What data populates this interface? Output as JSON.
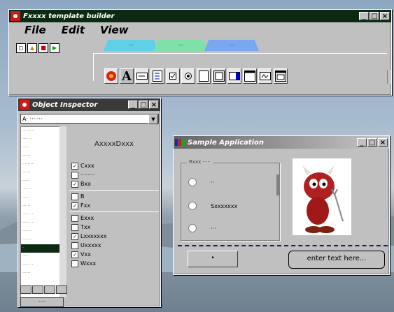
{
  "builder": {
    "title": "Fxxxx template builder",
    "menu": [
      "File",
      "Edit",
      "View"
    ],
    "tabs": [
      {
        "label": "···",
        "color": "#5fd0e8"
      },
      {
        "label": "···",
        "color": "#7fe0a8"
      },
      {
        "label": "···",
        "color": "#7aa8f0"
      }
    ],
    "palette_icons": [
      "flower-icon",
      "letter-a-icon",
      "textfield-icon",
      "listbox-icon",
      "checkbox-icon",
      "radio-icon",
      "frame-icon",
      "image-icon",
      "combobox-icon",
      "panel-icon",
      "groupbox-icon",
      "form-icon"
    ]
  },
  "inspector": {
    "title": "Object Inspector",
    "combo_value": "A· ·······",
    "properties": [
      "··· ·····",
      "···· ··",
      "·····",
      "······",
      "· ······",
      "······",
      "·····",
      "···· ··",
      "·····",
      "··· ··",
      "····· ··",
      "····· ··",
      "·······",
      "·······",
      "·",
      "·····",
      "····· ··",
      "······"
    ],
    "selected_index": 14,
    "align_label": "AxxxxDxxx",
    "checks": [
      {
        "label": "Cxxx",
        "checked": true
      },
      {
        "label": "········",
        "checked": false
      },
      {
        "label": "Bxx",
        "checked": true
      },
      {
        "label": "B",
        "checked": false
      },
      {
        "label": "Fxx",
        "checked": true
      },
      {
        "label": "Exxx",
        "checked": false
      },
      {
        "label": "Txx",
        "checked": false
      },
      {
        "label": "Lxxxxxxx",
        "checked": true
      },
      {
        "label": "Uxxxxx",
        "checked": false
      },
      {
        "label": "Vxx",
        "checked": true
      },
      {
        "label": "Wxxx",
        "checked": false
      }
    ],
    "ok_label": "····"
  },
  "sample": {
    "title": "Sample Application",
    "group_label": "Rxxx ·····",
    "radios": [
      "··",
      "Sxxxxxxx",
      "···"
    ],
    "button_label": "•",
    "edit_text": "enter text here..."
  }
}
